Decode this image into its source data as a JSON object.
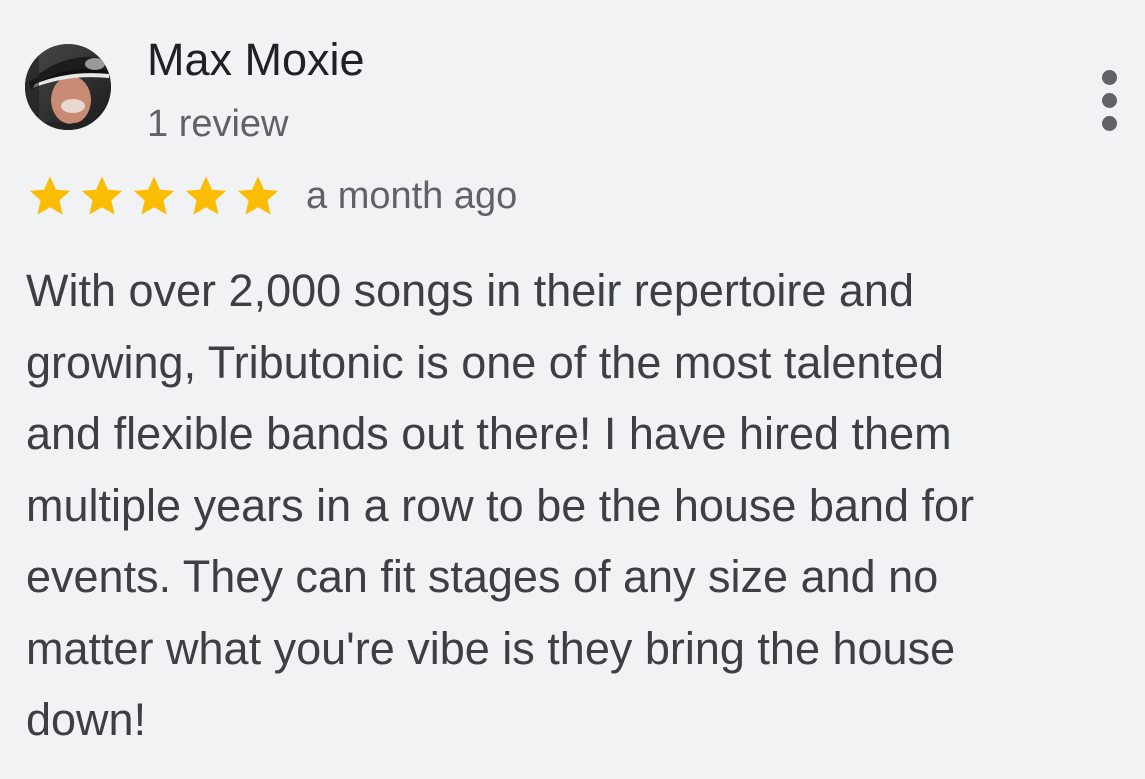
{
  "review": {
    "author_name": "Max Moxie",
    "review_count": "1 review",
    "rating": 5,
    "rating_max": 5,
    "date": "a month ago",
    "text": "With over 2,000 songs in their repertoire and\ngrowing, Tributonic is one of the most talented\nand flexible bands out there! I have hired them\nmultiple years in a row to be the house band for\nevents. They can fit stages of any size and no\nmatter what you're vibe is they bring the house\ndown!"
  },
  "icons": {
    "avatar": "avatar-photo",
    "menu": "more-vert-icon",
    "star": "star-icon"
  },
  "colors": {
    "background": "#f1f2f4",
    "star": "#fbbc04",
    "name": "#202124",
    "secondary": "#5f6368",
    "body_text": "#3c4043"
  }
}
